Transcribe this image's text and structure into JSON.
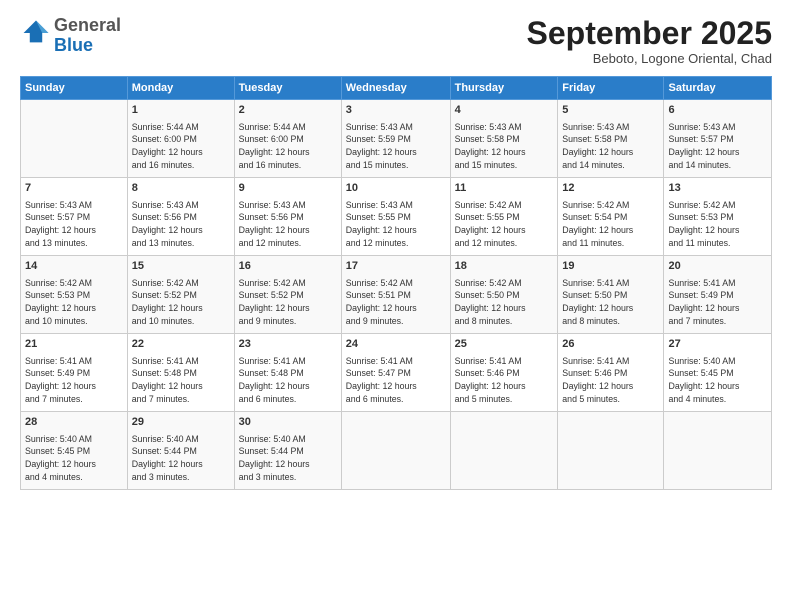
{
  "header": {
    "logo_line1": "General",
    "logo_line2": "Blue",
    "month": "September 2025",
    "location": "Beboto, Logone Oriental, Chad"
  },
  "weekdays": [
    "Sunday",
    "Monday",
    "Tuesday",
    "Wednesday",
    "Thursday",
    "Friday",
    "Saturday"
  ],
  "weeks": [
    [
      {
        "day": "",
        "info": ""
      },
      {
        "day": "1",
        "info": "Sunrise: 5:44 AM\nSunset: 6:00 PM\nDaylight: 12 hours\nand 16 minutes."
      },
      {
        "day": "2",
        "info": "Sunrise: 5:44 AM\nSunset: 6:00 PM\nDaylight: 12 hours\nand 16 minutes."
      },
      {
        "day": "3",
        "info": "Sunrise: 5:43 AM\nSunset: 5:59 PM\nDaylight: 12 hours\nand 15 minutes."
      },
      {
        "day": "4",
        "info": "Sunrise: 5:43 AM\nSunset: 5:58 PM\nDaylight: 12 hours\nand 15 minutes."
      },
      {
        "day": "5",
        "info": "Sunrise: 5:43 AM\nSunset: 5:58 PM\nDaylight: 12 hours\nand 14 minutes."
      },
      {
        "day": "6",
        "info": "Sunrise: 5:43 AM\nSunset: 5:57 PM\nDaylight: 12 hours\nand 14 minutes."
      }
    ],
    [
      {
        "day": "7",
        "info": "Sunrise: 5:43 AM\nSunset: 5:57 PM\nDaylight: 12 hours\nand 13 minutes."
      },
      {
        "day": "8",
        "info": "Sunrise: 5:43 AM\nSunset: 5:56 PM\nDaylight: 12 hours\nand 13 minutes."
      },
      {
        "day": "9",
        "info": "Sunrise: 5:43 AM\nSunset: 5:56 PM\nDaylight: 12 hours\nand 12 minutes."
      },
      {
        "day": "10",
        "info": "Sunrise: 5:43 AM\nSunset: 5:55 PM\nDaylight: 12 hours\nand 12 minutes."
      },
      {
        "day": "11",
        "info": "Sunrise: 5:42 AM\nSunset: 5:55 PM\nDaylight: 12 hours\nand 12 minutes."
      },
      {
        "day": "12",
        "info": "Sunrise: 5:42 AM\nSunset: 5:54 PM\nDaylight: 12 hours\nand 11 minutes."
      },
      {
        "day": "13",
        "info": "Sunrise: 5:42 AM\nSunset: 5:53 PM\nDaylight: 12 hours\nand 11 minutes."
      }
    ],
    [
      {
        "day": "14",
        "info": "Sunrise: 5:42 AM\nSunset: 5:53 PM\nDaylight: 12 hours\nand 10 minutes."
      },
      {
        "day": "15",
        "info": "Sunrise: 5:42 AM\nSunset: 5:52 PM\nDaylight: 12 hours\nand 10 minutes."
      },
      {
        "day": "16",
        "info": "Sunrise: 5:42 AM\nSunset: 5:52 PM\nDaylight: 12 hours\nand 9 minutes."
      },
      {
        "day": "17",
        "info": "Sunrise: 5:42 AM\nSunset: 5:51 PM\nDaylight: 12 hours\nand 9 minutes."
      },
      {
        "day": "18",
        "info": "Sunrise: 5:42 AM\nSunset: 5:50 PM\nDaylight: 12 hours\nand 8 minutes."
      },
      {
        "day": "19",
        "info": "Sunrise: 5:41 AM\nSunset: 5:50 PM\nDaylight: 12 hours\nand 8 minutes."
      },
      {
        "day": "20",
        "info": "Sunrise: 5:41 AM\nSunset: 5:49 PM\nDaylight: 12 hours\nand 7 minutes."
      }
    ],
    [
      {
        "day": "21",
        "info": "Sunrise: 5:41 AM\nSunset: 5:49 PM\nDaylight: 12 hours\nand 7 minutes."
      },
      {
        "day": "22",
        "info": "Sunrise: 5:41 AM\nSunset: 5:48 PM\nDaylight: 12 hours\nand 7 minutes."
      },
      {
        "day": "23",
        "info": "Sunrise: 5:41 AM\nSunset: 5:48 PM\nDaylight: 12 hours\nand 6 minutes."
      },
      {
        "day": "24",
        "info": "Sunrise: 5:41 AM\nSunset: 5:47 PM\nDaylight: 12 hours\nand 6 minutes."
      },
      {
        "day": "25",
        "info": "Sunrise: 5:41 AM\nSunset: 5:46 PM\nDaylight: 12 hours\nand 5 minutes."
      },
      {
        "day": "26",
        "info": "Sunrise: 5:41 AM\nSunset: 5:46 PM\nDaylight: 12 hours\nand 5 minutes."
      },
      {
        "day": "27",
        "info": "Sunrise: 5:40 AM\nSunset: 5:45 PM\nDaylight: 12 hours\nand 4 minutes."
      }
    ],
    [
      {
        "day": "28",
        "info": "Sunrise: 5:40 AM\nSunset: 5:45 PM\nDaylight: 12 hours\nand 4 minutes."
      },
      {
        "day": "29",
        "info": "Sunrise: 5:40 AM\nSunset: 5:44 PM\nDaylight: 12 hours\nand 3 minutes."
      },
      {
        "day": "30",
        "info": "Sunrise: 5:40 AM\nSunset: 5:44 PM\nDaylight: 12 hours\nand 3 minutes."
      },
      {
        "day": "",
        "info": ""
      },
      {
        "day": "",
        "info": ""
      },
      {
        "day": "",
        "info": ""
      },
      {
        "day": "",
        "info": ""
      }
    ]
  ]
}
